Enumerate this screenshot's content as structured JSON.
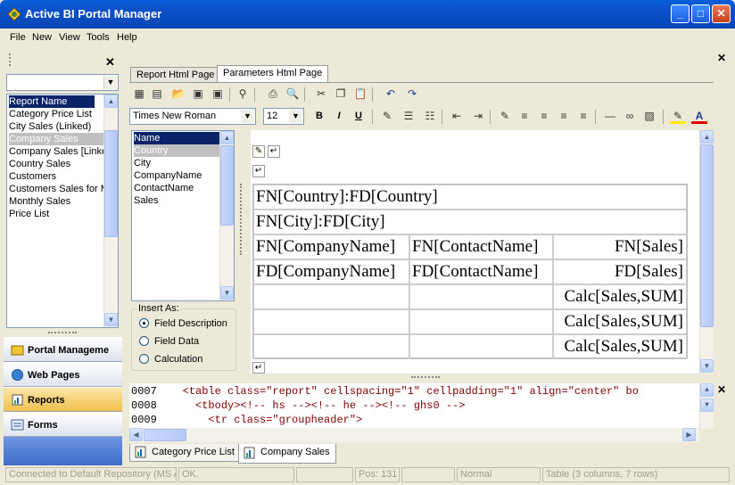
{
  "window": {
    "title": "Active BI Portal Manager",
    "minimize": "_",
    "maximize": "□",
    "close": "✕"
  },
  "menu": [
    "File",
    "New",
    "View",
    "Tools",
    "Help"
  ],
  "left_panel": {
    "close": "✕",
    "combo_value": "",
    "reports": [
      "Report Name",
      "Category Price List",
      "City Sales (Linked)",
      "Company Sales",
      "Company Sales [Linke",
      "Country Sales",
      "Customers",
      "Customers Sales for M",
      "Monthly Sales",
      "Price List"
    ],
    "nav": [
      "Portal Manageme",
      "Web Pages",
      "Reports",
      "Forms"
    ]
  },
  "main": {
    "close": "✕",
    "tabs": [
      "Report Html Page",
      "Parameters Html Page"
    ],
    "font_name": "Times New Roman",
    "font_size": "12",
    "format_bold": "B",
    "format_italic": "I",
    "format_underline": "U",
    "fields": [
      "Name",
      "Country",
      "City",
      "CompanyName",
      "ContactName",
      "Sales"
    ],
    "insert_as": {
      "label": "Insert As:",
      "options": [
        "Field Description",
        "Field Data",
        "Calculation"
      ],
      "selected": 0
    },
    "para_mark": "↵",
    "table": {
      "rows": [
        [
          "FN[Country]:FD[Country]"
        ],
        [
          "FN[City]:FD[City]"
        ],
        [
          "FN[CompanyName]",
          "FN[ContactName]",
          "FN[Sales]"
        ],
        [
          "FD[CompanyName]",
          "FD[ContactName]",
          "FD[Sales]"
        ],
        [
          "",
          "",
          "Calc[Sales,SUM]"
        ],
        [
          "",
          "",
          "Calc[Sales,SUM]"
        ],
        [
          "",
          "",
          "Calc[Sales,SUM]"
        ]
      ]
    },
    "code": [
      {
        "num": "0007",
        "text": "    <table class=\"report\" cellspacing=\"1\" cellpadding=\"1\" align=\"center\" bo"
      },
      {
        "num": "0008",
        "text": "      <tbody><!-- hs --><!-- he --><!-- ghs0 -->"
      },
      {
        "num": "0009",
        "text": "        <tr class=\"groupheader\">"
      }
    ],
    "bottom_tabs": [
      "Category Price List",
      "Company Sales"
    ]
  },
  "status": [
    "Connected to Default Repository (MS A",
    "OK.",
    "",
    "Pos: 131",
    "",
    "Normal",
    "Table (3 columns, 7 rows)"
  ]
}
